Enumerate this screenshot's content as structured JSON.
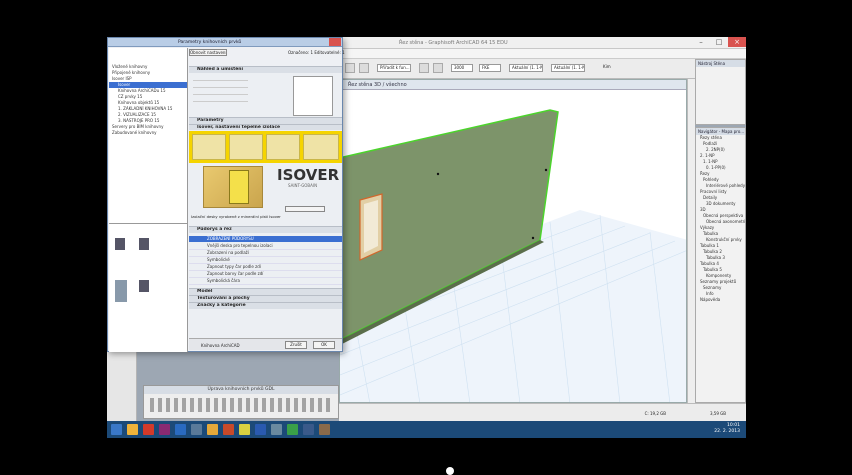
{
  "app": {
    "window_title": "Řez stěna - Graphisoft ArchiCAD 64 15 EDU",
    "view_tab": "Řez stěna 3D / všechno"
  },
  "toolbar": {
    "field1": "Přiřadit k fun...",
    "field2": "3000",
    "field3": "FKE",
    "layer_value": "Aktuální (1. 1-NP)",
    "zoom_label": "Kim"
  },
  "navigator": {
    "panel1_title": "Nástroj Stěna",
    "panel2_title": "Navigátor - Mapa pro...",
    "tree": [
      "Řezy stěna",
      "Podlaží",
      "2. 2NP(0)",
      "2. 1-NP",
      "1. 1-NP",
      "0. 1-PP(0)",
      "Řezy",
      "Pohledy",
      "Interiérové pohledy",
      "Pracovní listy",
      "Detaily",
      "3D dokumenty",
      "3D",
      "Obecná perspektiva",
      "Obecná axonometrie",
      "Výkazy",
      "Tabulka",
      "Konstrukční prvky",
      "Tabulka 1",
      "Tabulka 2",
      "Tabulka 3",
      "Tabulka 4",
      "Tabulka 5",
      "Komponenty",
      "Seznamy projektů",
      "Seznamy",
      "Info",
      "Nápověda"
    ]
  },
  "library": {
    "title": "Parametry knihovních prvků",
    "top_button": "Obnovit nastavení...",
    "top_right": "Označeno: 1 Editovatelné: 1",
    "folders": [
      "Vložené knihovny",
      "Připojené knihovny",
      "Isover ISP",
      "Isover",
      "Knihovna ArchiCADu 15",
      "CZ prvky 15",
      "Knihovna objektů 15",
      "1. ZÁKLADNÍ KNIHOVNA 15",
      "2. VIZUALIZACE 15",
      "3. NÁSTROJE PRO 15",
      "Servery pro BIM knihovny",
      "Zabudované knihovny"
    ],
    "sections": [
      "Náhled a umístění",
      "Parametry",
      "Isover, nastavení tepelné izolace",
      "Půdorys a řez",
      "Model",
      "Texturování a plochy",
      "Značky a kategorie"
    ],
    "params": [
      "Vnější deska pro tepelnou izolaci",
      "Zobrazení na podlaží",
      "Symbolické",
      "Zapnout typy čar podle zdí",
      "Zapnout barvy čar podle zdí",
      "Symbolická čára"
    ],
    "isover_logo": "ISOVER",
    "isover_sub": "SAINT-GOBAIN",
    "isover_text": "Izolační desky vyrobené z minerální plsti Isover",
    "selected_row": "ZOBRAZENÍ PŮDORYSU",
    "footer_buttons": [
      "Zrušit",
      "OK"
    ],
    "footer_label": "Knihovna ArchiCAD"
  },
  "gdl_palette": {
    "title": "Úprava knihovních prvků GDL"
  },
  "taskbar": {
    "time": "10:01",
    "date": "22. 2. 2013",
    "status_left": "C: 19,2 GB",
    "status_right": "3,59 GB"
  },
  "colors": {
    "wall": "#7d946a",
    "wall_edge": "#4cd42c",
    "grid": "#cfe1f1",
    "isover_yellow": "#f5d400",
    "taskbar": "#1c4a78"
  }
}
